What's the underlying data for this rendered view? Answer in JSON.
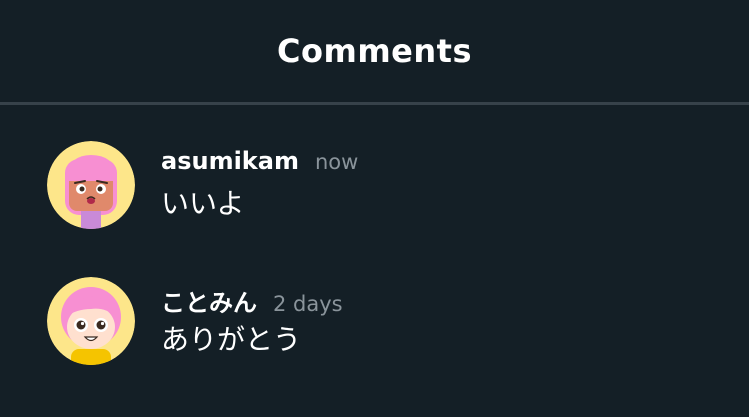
{
  "header": {
    "title": "Comments"
  },
  "comments": [
    {
      "username": "asumikam",
      "timestamp": "now",
      "text": "いいよ",
      "avatar_icon": "pink-haired-character-avatar-icon"
    },
    {
      "username": "ことみん",
      "timestamp": "2 days",
      "text": "ありがとう",
      "avatar_icon": "smiling-pink-haired-character-avatar-icon"
    }
  ],
  "colors": {
    "background": "#141f26",
    "divider": "#37424a",
    "text_primary": "#ffffff",
    "text_secondary": "#8a949b",
    "avatar_bg": "#fde68a",
    "hair_pink": "#f78fd2"
  }
}
